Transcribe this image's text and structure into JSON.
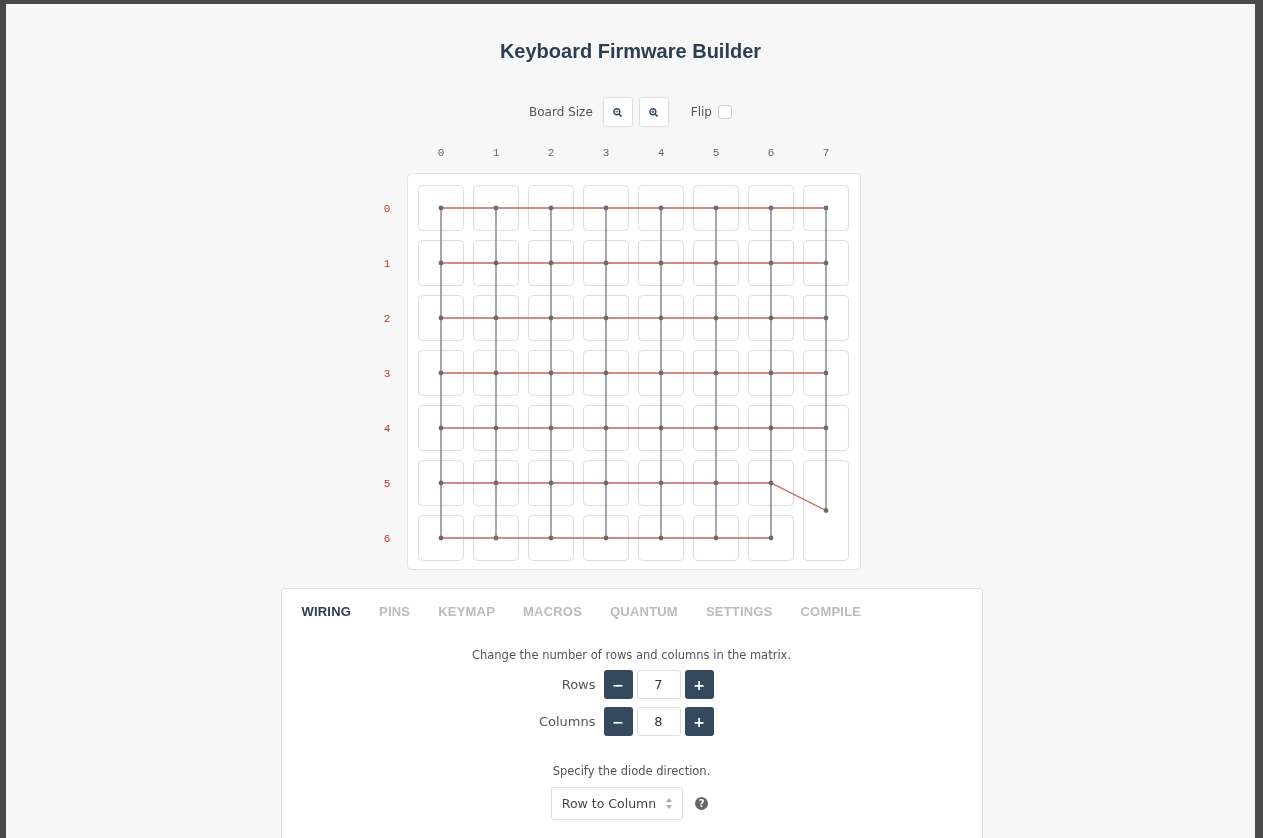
{
  "title": "Keyboard Firmware Builder",
  "toolbar": {
    "board_size_label": "Board Size",
    "flip_label": "Flip",
    "flip": false
  },
  "board": {
    "column_labels": [
      "0",
      "1",
      "2",
      "3",
      "4",
      "5",
      "6",
      "7"
    ],
    "rows": [
      {
        "label": "0",
        "keys": [
          {
            "kind": "unit"
          },
          {
            "kind": "unit"
          },
          {
            "kind": "unit"
          },
          {
            "kind": "unit"
          },
          {
            "kind": "unit"
          },
          {
            "kind": "unit"
          },
          {
            "kind": "unit"
          },
          {
            "kind": "unit"
          }
        ]
      },
      {
        "label": "1",
        "keys": [
          {
            "kind": "unit"
          },
          {
            "kind": "unit"
          },
          {
            "kind": "unit"
          },
          {
            "kind": "unit"
          },
          {
            "kind": "unit"
          },
          {
            "kind": "unit"
          },
          {
            "kind": "unit"
          },
          {
            "kind": "unit"
          }
        ]
      },
      {
        "label": "2",
        "keys": [
          {
            "kind": "unit"
          },
          {
            "kind": "unit"
          },
          {
            "kind": "unit"
          },
          {
            "kind": "unit"
          },
          {
            "kind": "unit"
          },
          {
            "kind": "unit"
          },
          {
            "kind": "unit"
          },
          {
            "kind": "unit"
          }
        ]
      },
      {
        "label": "3",
        "keys": [
          {
            "kind": "unit"
          },
          {
            "kind": "unit"
          },
          {
            "kind": "unit"
          },
          {
            "kind": "unit"
          },
          {
            "kind": "unit"
          },
          {
            "kind": "unit"
          },
          {
            "kind": "unit"
          },
          {
            "kind": "unit"
          }
        ]
      },
      {
        "label": "4",
        "keys": [
          {
            "kind": "unit"
          },
          {
            "kind": "unit"
          },
          {
            "kind": "unit"
          },
          {
            "kind": "unit"
          },
          {
            "kind": "unit"
          },
          {
            "kind": "unit"
          },
          {
            "kind": "unit"
          },
          {
            "kind": "unit"
          }
        ]
      },
      {
        "label": "5",
        "keys": [
          {
            "kind": "unit"
          },
          {
            "kind": "unit"
          },
          {
            "kind": "unit"
          },
          {
            "kind": "unit"
          },
          {
            "kind": "unit"
          },
          {
            "kind": "unit"
          },
          {
            "kind": "unit"
          },
          {
            "kind": "tall"
          }
        ]
      },
      {
        "label": "6",
        "keys": [
          {
            "kind": "unit"
          },
          {
            "kind": "unit"
          },
          {
            "kind": "unit"
          },
          {
            "kind": "unit"
          },
          {
            "kind": "unit"
          },
          {
            "kind": "unit"
          },
          {
            "kind": "unit"
          }
        ]
      }
    ]
  },
  "tabs": [
    {
      "label": "WIRING",
      "selected": true
    },
    {
      "label": "PINS",
      "selected": false
    },
    {
      "label": "KEYMAP",
      "selected": false
    },
    {
      "label": "MACROS",
      "selected": false
    },
    {
      "label": "QUANTUM",
      "selected": false
    },
    {
      "label": "SETTINGS",
      "selected": false
    },
    {
      "label": "COMPILE",
      "selected": false
    }
  ],
  "wiring": {
    "matrix_hint": "Change the number of rows and columns in the matrix.",
    "steppers": [
      {
        "label": "Rows",
        "value": "7",
        "decrement": "−",
        "increment": "+"
      },
      {
        "label": "Columns",
        "value": "8",
        "decrement": "−",
        "increment": "+"
      }
    ],
    "diode_hint": "Specify the diode direction.",
    "diode_direction": "Row to Column",
    "help": "?"
  }
}
